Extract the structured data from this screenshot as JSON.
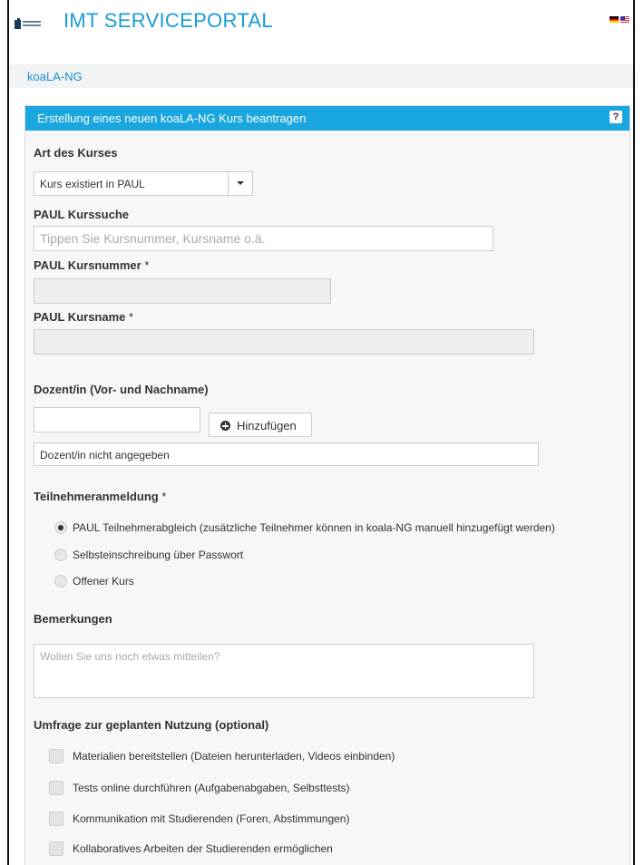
{
  "header": {
    "title": "IMT SERVICEPORTAL",
    "flags": [
      "german-flag-icon",
      "us-flag-icon"
    ]
  },
  "breadcrumb": {
    "label": "koaLA-NG"
  },
  "panel": {
    "title": "Erstellung eines neuen koaLA-NG Kurs beantragen",
    "help": "?"
  },
  "form": {
    "course_type": {
      "label": "Art des Kurses",
      "value": "Kurs existiert in PAUL"
    },
    "course_search": {
      "label": "PAUL Kurssuche",
      "placeholder": "Tippen Sie Kursnummer, Kursname o.ä."
    },
    "course_number": {
      "label": "PAUL Kursnummer",
      "required": "*"
    },
    "course_name": {
      "label": "PAUL Kursname",
      "required": "*"
    },
    "lecturer": {
      "label": "Dozent/in (Vor- und Nachname)",
      "add_button": "Hinzufügen",
      "empty_text": "Dozent/in nicht angegeben"
    },
    "enrollment": {
      "label": "Teilnehmeranmeldung",
      "required": "*",
      "options": [
        {
          "label": "PAUL Teilnehmerabgleich (zusätzliche Teilnehmer können in koala-NG manuell hinzugefügt werden)",
          "selected": true
        },
        {
          "label": "Selbsteinschreibung über Passwort",
          "selected": false
        },
        {
          "label": "Offener Kurs",
          "selected": false
        }
      ]
    },
    "remarks": {
      "label": "Bemerkungen",
      "placeholder": "Wollen Sie uns noch etwas mitteilen?"
    },
    "survey": {
      "label": "Umfrage zur geplanten Nutzung (optional)",
      "options": [
        "Materialien bereitstellen (Dateien herunterladen, Videos einbinden)",
        "Tests online durchführen (Aufgabenabgaben, Selbsttests)",
        "Kommunikation mit Studierenden (Foren, Abstimmungen)",
        "Kollaboratives Arbeiten der Studierenden ermöglichen"
      ]
    }
  },
  "colors": {
    "accent": "#1aa6df",
    "title": "#1a9bd7",
    "link": "#1a8fcf"
  }
}
